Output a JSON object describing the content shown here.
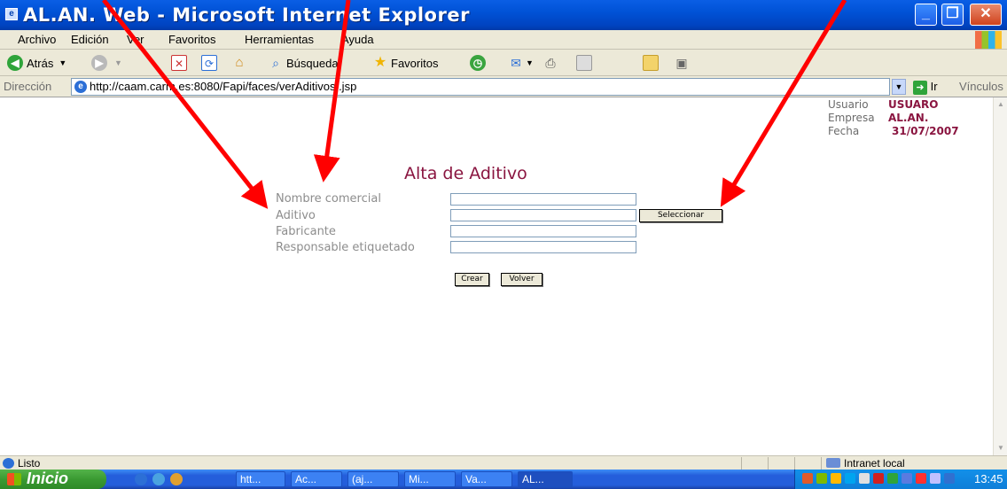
{
  "window": {
    "title": "AL.AN. Web - Microsoft Internet Explorer"
  },
  "menu": [
    "Archivo",
    "Edición",
    "Ver",
    "Favoritos",
    "Herramientas",
    "Ayuda"
  ],
  "toolbar": {
    "back_label": "Atrás",
    "search_label": "Búsqueda",
    "favorites_label": "Favoritos"
  },
  "address": {
    "label": "Dirección",
    "url": "http://caam.carm.es:8080/Fapi/faces/verAditivosI.jsp",
    "go_label": "Ir",
    "links_label": "Vínculos"
  },
  "user_info": {
    "usuario_label": "Usuario",
    "usuario_value": "USUARO",
    "empresa_label": "Empresa",
    "empresa_value": "AL.AN.",
    "fecha_label": "Fecha",
    "fecha_value": "31/07/2007"
  },
  "form": {
    "heading": "Alta de Aditivo",
    "fields": [
      {
        "label": "Nombre comercial",
        "value": ""
      },
      {
        "label": "Aditivo",
        "value": ""
      },
      {
        "label": "Fabricante",
        "value": ""
      },
      {
        "label": "Responsable etiquetado",
        "value": ""
      }
    ],
    "select_button": "Seleccionar",
    "create_button": "Crear",
    "back_button": "Volver"
  },
  "status": {
    "text": "Listo",
    "zone": "Intranet local"
  },
  "taskbar": {
    "start_label": "Inicio",
    "tasks": [
      "htt...",
      "Ac...",
      "(aj...",
      "Mi...",
      "Va...",
      "AL..."
    ],
    "clock": "13:45"
  },
  "colors": {
    "heading": "#8a1540",
    "label_gray": "#8d8d8d",
    "annotation_arrow": "#ff0000"
  },
  "icons": [
    "ie-icon",
    "back-arrow-icon",
    "forward-arrow-icon",
    "stop-icon",
    "refresh-icon",
    "home-icon",
    "search-icon",
    "favorites-star-icon",
    "history-icon",
    "mail-icon",
    "print-icon",
    "edit-icon",
    "folder-icon",
    "go-arrow-icon",
    "windows-flag-icon"
  ]
}
